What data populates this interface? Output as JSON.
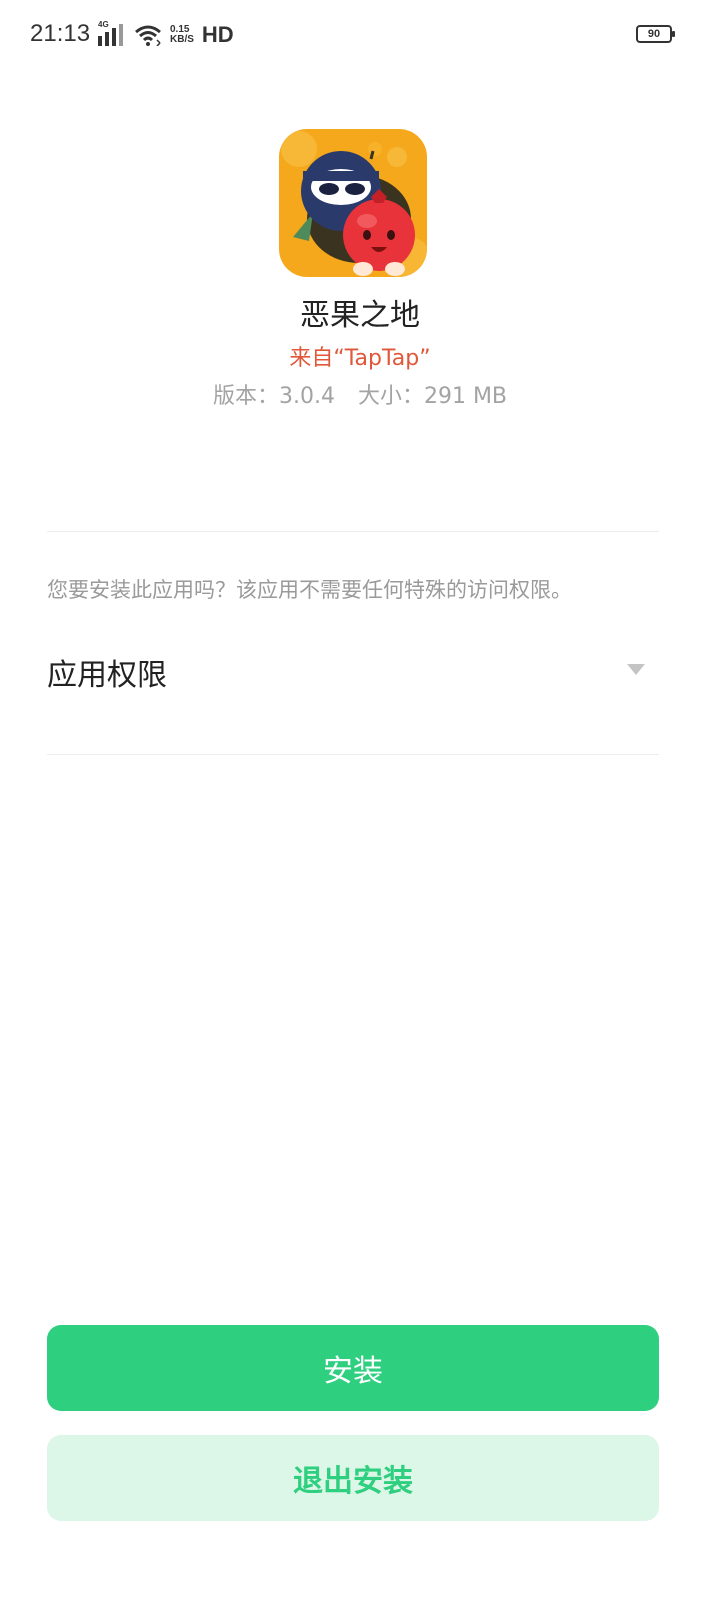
{
  "status_bar": {
    "time": "21:13",
    "network": "4G",
    "speed_value": "0.15",
    "speed_unit": "KB/S",
    "hd": "HD",
    "battery": "90"
  },
  "app": {
    "name": "恶果之地",
    "source": "来自“TapTap”",
    "version": "版本：3.0.4",
    "size": "大小：291 MB",
    "icon": "game-app-icon"
  },
  "install": {
    "question": "您要安装此应用吗？该应用不需要任何特殊的访问权限。",
    "permissions_label": "应用权限",
    "install_button": "安装",
    "cancel_button": "退出安装"
  },
  "colors": {
    "accent": "#2ecf7f",
    "accent_light": "#dcf6e8",
    "source": "#e0573a"
  }
}
